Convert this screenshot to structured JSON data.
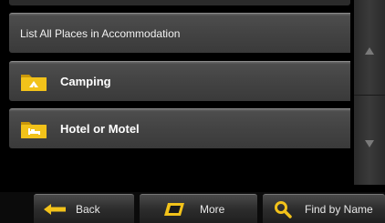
{
  "list": {
    "header_label": "List All Places in Accommodation",
    "items": [
      {
        "label": "Camping",
        "icon": "camping-folder-icon"
      },
      {
        "label": "Hotel or Motel",
        "icon": "hotel-folder-icon"
      }
    ]
  },
  "scroll": {
    "up_icon": "scroll-up-arrow-icon",
    "down_icon": "scroll-down-arrow-icon"
  },
  "toolbar": {
    "back_label": "Back",
    "more_label": "More",
    "find_label": "Find by Name"
  },
  "colors": {
    "folder_yellow": "#f2c21a",
    "folder_dark": "#c9970a",
    "row_top": "#6a6a6a",
    "row_bottom": "#3a3a3a",
    "background": "#000000"
  }
}
